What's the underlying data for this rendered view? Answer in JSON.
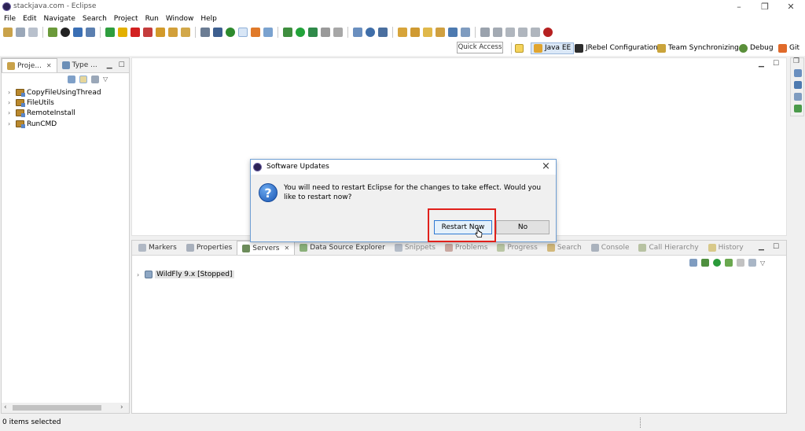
{
  "window": {
    "title": "stackjava.com - Eclipse",
    "minimize": "–",
    "restore": "❐",
    "close": "✕"
  },
  "menu": [
    "File",
    "Edit",
    "Navigate",
    "Search",
    "Project",
    "Run",
    "Window",
    "Help"
  ],
  "quick_access": {
    "placeholder": "Quick Access"
  },
  "perspectives": {
    "java_ee": "Java EE",
    "jrebel": "JRebel Configuration",
    "team_sync": "Team Synchronizing",
    "debug": "Debug",
    "git": "Git"
  },
  "left_panel": {
    "tabs": [
      "Proje...",
      "Type ..."
    ],
    "projects": [
      "CopyFileUsingThread",
      "FileUtils",
      "RemoteInstall",
      "RunCMD"
    ]
  },
  "bottom_panel": {
    "tabs": [
      "Markers",
      "Properties",
      "Servers",
      "Data Source Explorer",
      "Snippets",
      "Problems",
      "Progress",
      "Search",
      "Console",
      "Call Hierarchy",
      "History"
    ],
    "active_tab": "Servers",
    "server": {
      "name": "WildFly 9.x",
      "state": "[Stopped]"
    }
  },
  "dialog": {
    "title": "Software Updates",
    "message": "You will need to restart Eclipse for the changes to take effect. Would you like to restart now?",
    "restart_button": "Restart Now",
    "no_button": "No",
    "icon": "question-icon"
  },
  "status": {
    "text": "0 items selected"
  },
  "colors": {
    "highlight": "#e0201b",
    "accent": "#2f7ad3",
    "project_folder": "#b9882d"
  }
}
